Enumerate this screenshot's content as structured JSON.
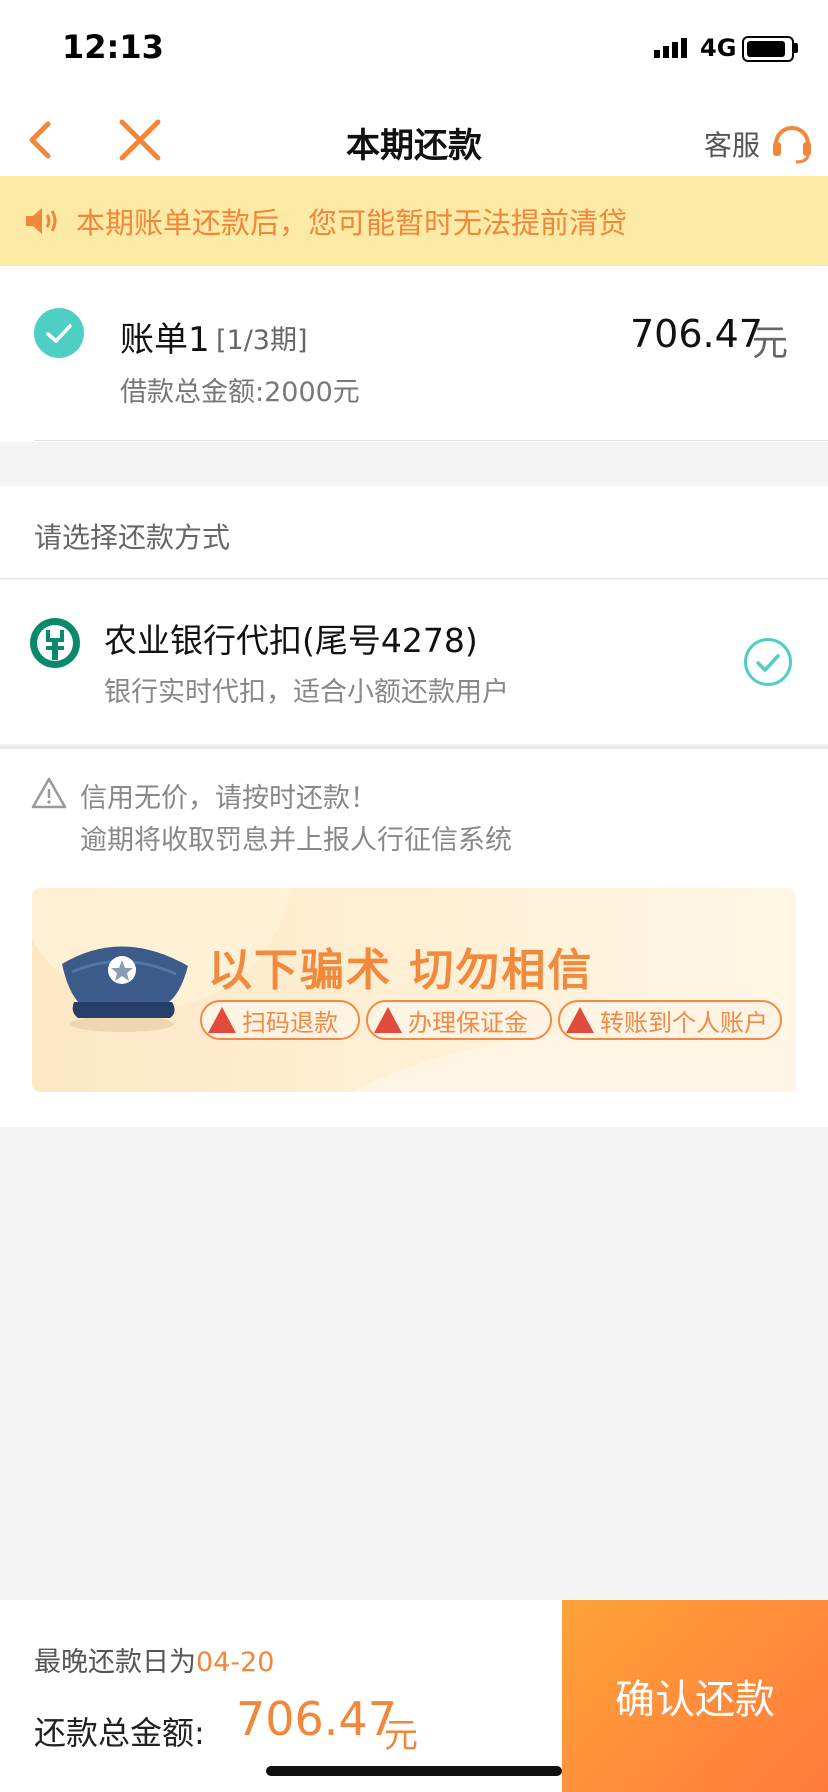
{
  "status_bar": {
    "time": "12:13",
    "network": "4G"
  },
  "nav": {
    "title": "本期还款",
    "service_label": "客服"
  },
  "notice": {
    "text": "本期账单还款后，您可能暂时无法提前清贷"
  },
  "bill": {
    "name": "账单1",
    "period": "[1/3期]",
    "amount": "706.47",
    "unit": "元",
    "loan_total": "借款总金额:2000元"
  },
  "payment_method": {
    "section_title": "请选择还款方式",
    "bank_name": "农业银行代扣(尾号4278)",
    "bank_desc": "银行实时代扣，适合小额还款用户",
    "selected": true
  },
  "warning": {
    "line1": "信用无价，请按时还款！",
    "line2": "逾期将收取罚息并上报人行征信系统"
  },
  "fraud_banner": {
    "title": "以下骗术 切勿相信",
    "items": [
      "扫码退款",
      "办理保证金",
      "转账到个人账户"
    ]
  },
  "footer": {
    "due_label": "最晚还款日为",
    "due_date": "04-20",
    "total_label": "还款总金额:",
    "total_amount": "706.47",
    "total_unit": "元",
    "confirm_label": "确认还款"
  },
  "colors": {
    "accent": "#f2863a",
    "teal": "#4ecfc3",
    "notice_bg": "#fdeaa5"
  }
}
